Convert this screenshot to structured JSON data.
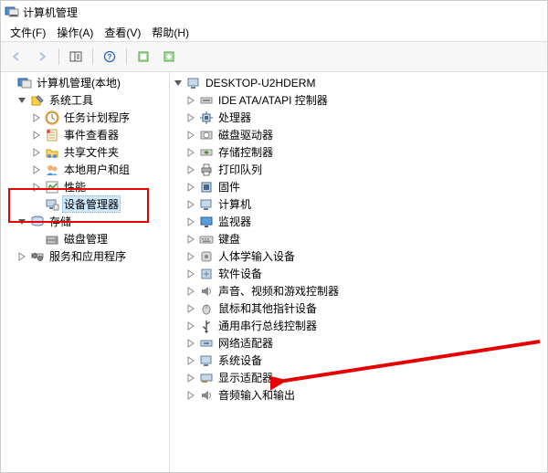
{
  "window": {
    "title": "计算机管理"
  },
  "menu": {
    "file": "文件(F)",
    "action": "操作(A)",
    "view": "查看(V)",
    "help": "帮助(H)"
  },
  "left_tree": {
    "root": {
      "label": "计算机管理(本地)"
    },
    "sys_tools": {
      "label": "系统工具"
    },
    "task_scheduler": {
      "label": "任务计划程序"
    },
    "event_viewer": {
      "label": "事件查看器"
    },
    "shared_folders": {
      "label": "共享文件夹"
    },
    "local_users": {
      "label": "本地用户和组"
    },
    "performance": {
      "label": "性能"
    },
    "device_manager": {
      "label": "设备管理器"
    },
    "storage": {
      "label": "存储"
    },
    "disk_mgmt": {
      "label": "磁盘管理"
    },
    "services_apps": {
      "label": "服务和应用程序"
    }
  },
  "right_tree": {
    "root": {
      "label": "DESKTOP-U2HDERM"
    },
    "ide": {
      "label": "IDE ATA/ATAPI 控制器"
    },
    "cpu": {
      "label": "处理器"
    },
    "disk_drives": {
      "label": "磁盘驱动器"
    },
    "storage_ctrl": {
      "label": "存储控制器"
    },
    "print_queues": {
      "label": "打印队列"
    },
    "firmware": {
      "label": "固件"
    },
    "computer": {
      "label": "计算机"
    },
    "monitor": {
      "label": "监视器"
    },
    "keyboard": {
      "label": "键盘"
    },
    "hid": {
      "label": "人体学输入设备"
    },
    "software_dev": {
      "label": "软件设备"
    },
    "audio_video": {
      "label": "声音、视频和游戏控制器"
    },
    "mouse": {
      "label": "鼠标和其他指针设备"
    },
    "usb": {
      "label": "通用串行总线控制器"
    },
    "network": {
      "label": "网络适配器"
    },
    "system_dev": {
      "label": "系统设备"
    },
    "display": {
      "label": "显示适配器"
    },
    "audio_io": {
      "label": "音频输入和输出"
    }
  }
}
